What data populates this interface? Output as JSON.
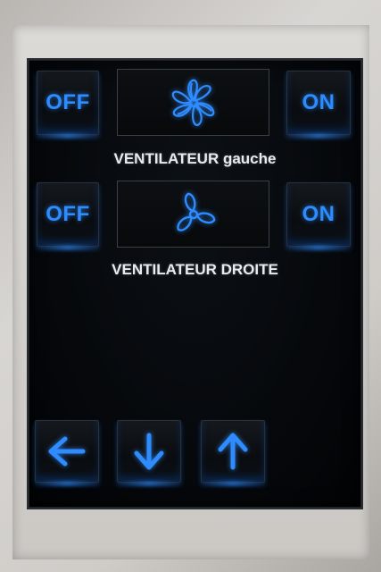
{
  "colors": {
    "accent": "#2f8cff",
    "label_text": "#e8ecef",
    "screen_bg": "#05070a"
  },
  "fan_left": {
    "off_label": "OFF",
    "on_label": "ON",
    "icon": "fan-spinning-icon",
    "title": "VENTILATEUR gauche"
  },
  "fan_right": {
    "off_label": "OFF",
    "on_label": "ON",
    "icon": "fan-icon",
    "title": "VENTILATEUR DROITE"
  },
  "nav": {
    "back_icon": "arrow-left-icon",
    "down_icon": "arrow-down-icon",
    "up_icon": "arrow-up-icon"
  }
}
